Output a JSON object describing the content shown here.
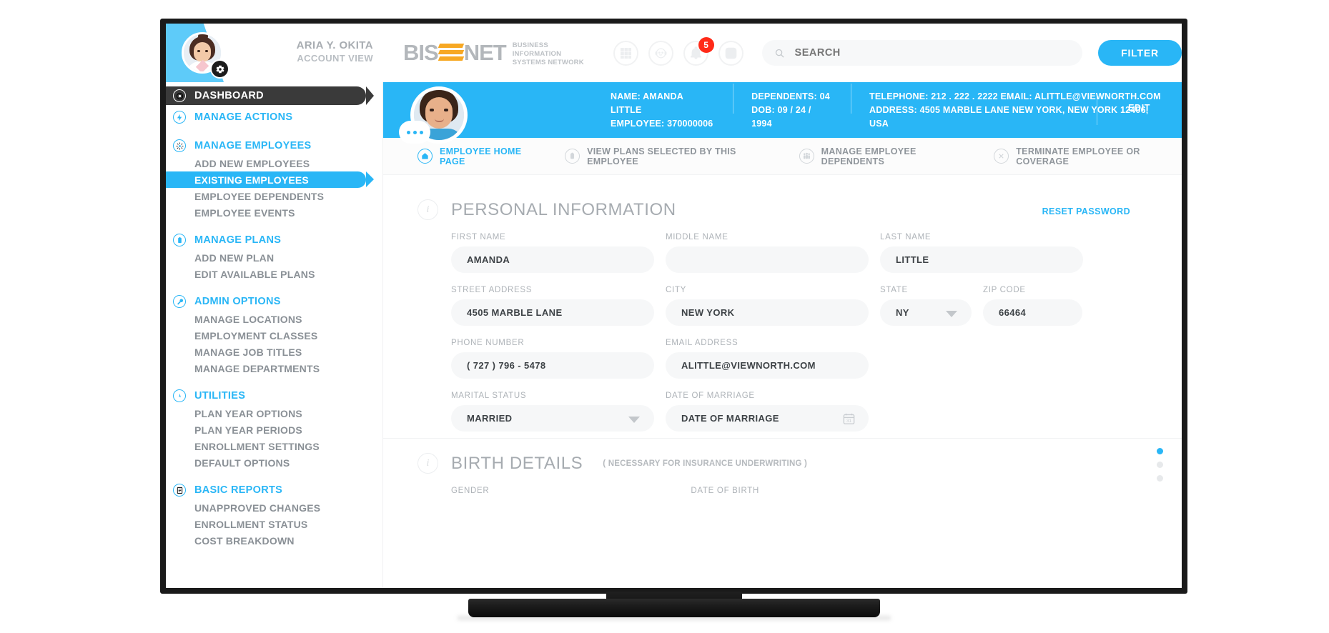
{
  "account": {
    "name": "ARIA Y. OKITA",
    "role": "ACCOUNT VIEW",
    "avatar_icon": "user-avatar",
    "settings_icon": "gear-icon"
  },
  "brand": {
    "name_part1": "BIS",
    "name_part2": "NET",
    "tagline_line1": "BUSINESS INFORMATION",
    "tagline_line2": "SYSTEMS NETWORK",
    "accent_orange": "#f7a823",
    "accent_blue": "#29b6f6"
  },
  "header_icons": [
    {
      "name": "apps-grid-icon",
      "badge": null
    },
    {
      "name": "support-agent-icon",
      "badge": null
    },
    {
      "name": "notifications-bell-icon",
      "badge": "5"
    },
    {
      "name": "logout-icon",
      "badge": null
    }
  ],
  "search": {
    "placeholder": "SEARCH",
    "value": "",
    "icon": "search-icon"
  },
  "filter_button": {
    "label": "FILTER"
  },
  "sidebar": {
    "groups": [
      {
        "label": "DASHBOARD",
        "icon": "target-icon",
        "state": "active",
        "items": []
      },
      {
        "label": "MANAGE ACTIONS",
        "icon": "bolt-icon",
        "state": "normal",
        "items": []
      },
      {
        "label": "MANAGE EMPLOYEES",
        "icon": "people-icon",
        "state": "normal",
        "items": [
          {
            "label": "ADD NEW EMPLOYEES",
            "selected": false
          },
          {
            "label": "EXISTING EMPLOYEES",
            "selected": true
          },
          {
            "label": "EMPLOYEE DEPENDENTS",
            "selected": false
          },
          {
            "label": "EMPLOYEE EVENTS",
            "selected": false
          }
        ]
      },
      {
        "label": "MANAGE PLANS",
        "icon": "clipboard-icon",
        "state": "normal",
        "items": [
          {
            "label": "ADD NEW PLAN",
            "selected": false
          },
          {
            "label": "EDIT AVAILABLE PLANS",
            "selected": false
          }
        ]
      },
      {
        "label": "ADMIN OPTIONS",
        "icon": "wrench-icon",
        "state": "normal",
        "items": [
          {
            "label": "MANAGE LOCATIONS",
            "selected": false
          },
          {
            "label": "EMPLOYMENT CLASSES",
            "selected": false
          },
          {
            "label": "MANAGE JOB TITLES",
            "selected": false
          },
          {
            "label": "MANAGE DEPARTMENTS",
            "selected": false
          }
        ]
      },
      {
        "label": "UTILITIES",
        "icon": "compass-icon",
        "state": "normal",
        "items": [
          {
            "label": "PLAN YEAR OPTIONS",
            "selected": false
          },
          {
            "label": "PLAN YEAR PERIODS",
            "selected": false
          },
          {
            "label": "ENROLLMENT SETTINGS",
            "selected": false
          },
          {
            "label": "DEFAULT OPTIONS",
            "selected": false
          }
        ]
      },
      {
        "label": "BASIC REPORTS",
        "icon": "report-icon",
        "state": "normal",
        "items": [
          {
            "label": "UNAPPROVED CHANGES",
            "selected": false
          },
          {
            "label": "ENROLLMENT STATUS",
            "selected": false
          },
          {
            "label": "COST BREAKDOWN",
            "selected": false
          }
        ]
      }
    ]
  },
  "employee_banner": {
    "avatar_icon": "employee-photo",
    "chat_icon": "chat-dots-icon",
    "col1_line1": "NAME: AMANDA LITTLE",
    "col1_line2": "EMPLOYEE: 370000006",
    "col2_line1": "DEPENDENTS: 04",
    "col2_line2": "DOB: 09 / 24 / 1994",
    "col3_line1": "TELEPHONE:  212 . 222 . 2222     EMAIL: ALITTLE@VIEWNORTH.COM",
    "col3_line2": "ADDRESS:  4505 MARBLE LANE  NEW YORK, NEW YORK 12406, USA",
    "edit_label": "EDIT"
  },
  "tabs": [
    {
      "label": "EMPLOYEE HOME PAGE",
      "icon": "home-icon",
      "active": true
    },
    {
      "label": "VIEW PLANS SELECTED BY THIS EMPLOYEE",
      "icon": "clipboard-icon",
      "active": false
    },
    {
      "label": "MANAGE EMPLOYEE DEPENDENTS",
      "icon": "family-icon",
      "active": false
    },
    {
      "label": "TERMINATE EMPLOYEE OR COVERAGE",
      "icon": "close-circle-icon",
      "active": false
    }
  ],
  "personal_information": {
    "title": "PERSONAL INFORMATION",
    "icon": "info-icon",
    "reset_password_label": "RESET PASSWORD",
    "fields": {
      "first_name": {
        "label": "FIRST NAME",
        "value": "AMANDA"
      },
      "middle_name": {
        "label": "MIDDLE NAME",
        "value": ""
      },
      "last_name": {
        "label": "LAST NAME",
        "value": "LITTLE"
      },
      "street_address": {
        "label": "STREET ADDRESS",
        "value": "4505 MARBLE LANE"
      },
      "city": {
        "label": "CITY",
        "value": "NEW YORK"
      },
      "state": {
        "label": "STATE",
        "value": "NY"
      },
      "zip_code": {
        "label": "ZIP CODE",
        "value": "66464"
      },
      "phone_number": {
        "label": "PHONE NUMBER",
        "value": "( 727 ) 796 - 5478"
      },
      "email_address": {
        "label": "EMAIL ADDRESS",
        "value": "ALITTLE@VIEWNORTH.COM"
      },
      "marital_status": {
        "label": "MARITAL STATUS",
        "value": "MARRIED"
      },
      "date_of_marriage": {
        "label": "DATE OF MARRIAGE",
        "value": "DATE OF MARRIAGE"
      }
    }
  },
  "birth_details": {
    "title": "BIRTH DETAILS",
    "note": "( NECESSARY FOR INSURANCE UNDERWRITING )",
    "icon": "info-icon",
    "fields": {
      "gender": {
        "label": "GENDER"
      },
      "date_of_birth": {
        "label": "DATE OF BIRTH"
      }
    }
  },
  "pagination_dots": {
    "total": 3,
    "active_index": 0
  }
}
